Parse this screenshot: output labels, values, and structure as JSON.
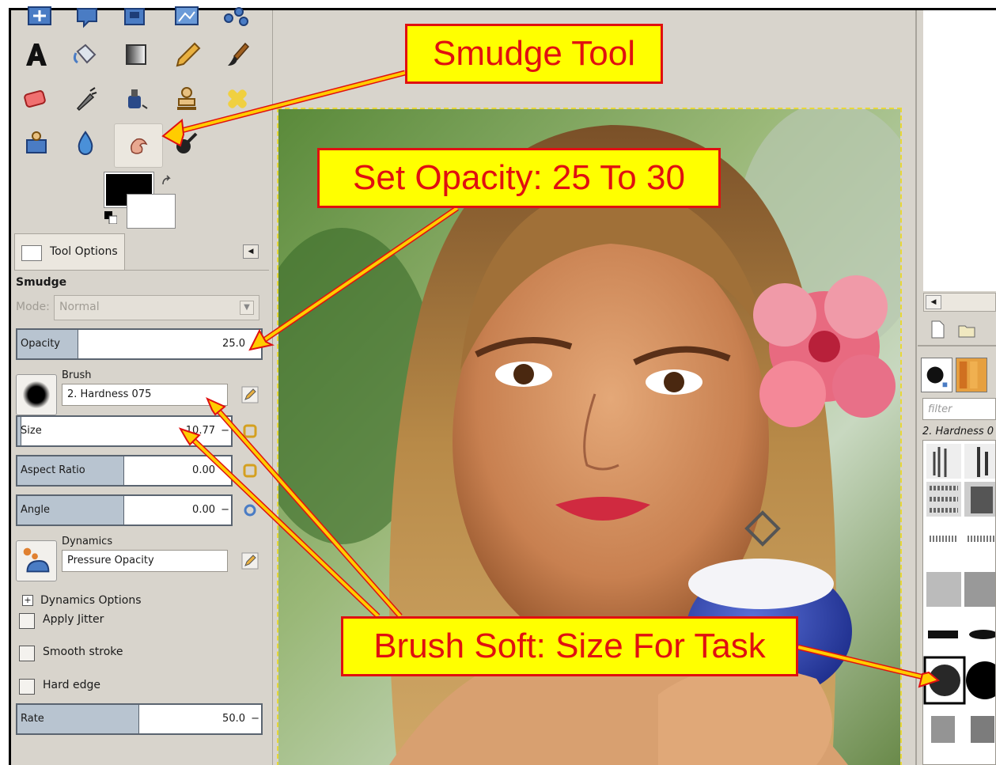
{
  "colors": {
    "panel": "#d8d4cc",
    "slider_fill": "#b8c4d0",
    "callout_bg": "#ffff00",
    "callout_text": "#e01010",
    "arrow": "#ffcc00"
  },
  "toolbox": {
    "tools": [
      "align-icon",
      "move-icon",
      "crop-icon",
      "transform-icon",
      "cage-icon",
      "text-icon",
      "bucket-fill-icon",
      "gradient-icon",
      "pencil-icon",
      "paintbrush-icon",
      "eraser-icon",
      "airbrush-icon",
      "ink-icon",
      "clone-icon",
      "heal-icon",
      "perspective-clone-icon",
      "blur-icon",
      "smudge-icon",
      "dodge-burn-icon"
    ],
    "active_tool": "smudge-icon"
  },
  "tool_options": {
    "tab_label": "Tool Options",
    "title": "Smudge",
    "mode_label": "Mode:",
    "mode_value": "Normal",
    "opacity": {
      "label": "Opacity",
      "value": "25.0",
      "level": 0.25
    },
    "brush": {
      "label": "Brush",
      "value": "2. Hardness 075"
    },
    "size": {
      "label": "Size",
      "value": "10.77",
      "level": 0.02
    },
    "aspect_ratio": {
      "label": "Aspect Ratio",
      "value": "0.00",
      "level": 0.5
    },
    "angle": {
      "label": "Angle",
      "value": "0.00",
      "level": 0.5
    },
    "dynamics": {
      "label": "Dynamics",
      "value": "Pressure Opacity"
    },
    "dynamics_options_label": "Dynamics Options",
    "apply_jitter": {
      "label": "Apply Jitter",
      "checked": false
    },
    "smooth_stroke": {
      "label": "Smooth stroke",
      "checked": false
    },
    "hard_edge": {
      "label": "Hard edge",
      "checked": false
    },
    "rate": {
      "label": "Rate",
      "value": "50.0",
      "level": 0.5
    }
  },
  "brushes_dock": {
    "filter_placeholder": "filter",
    "selected_brush": "2. Hardness 0"
  },
  "annotations": {
    "smudge_tool": "Smudge Tool",
    "set_opacity": "Set Opacity: 25 To 30",
    "brush_soft": "Brush Soft: Size For Task"
  }
}
